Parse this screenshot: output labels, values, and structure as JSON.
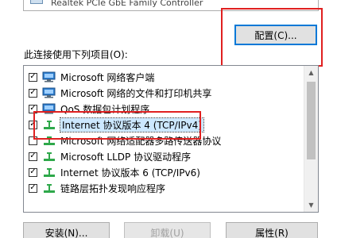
{
  "adapter": {
    "name": "Realtek PCIe GbE Family Controller"
  },
  "buttons": {
    "configure": "配置(C)...",
    "install": "安装(N)...",
    "uninstall": "卸载(U)",
    "properties": "属性(R)"
  },
  "section_label": "此连接使用下列项目(O):",
  "items": [
    {
      "label": "Microsoft 网络客户端",
      "checked": true,
      "icon": "network-client-icon"
    },
    {
      "label": "Microsoft 网络的文件和打印机共享",
      "checked": true,
      "icon": "network-client-icon"
    },
    {
      "label": "QoS 数据包计划程序",
      "checked": true,
      "icon": "network-client-icon"
    },
    {
      "label": "Internet 协议版本 4 (TCP/IPv4)",
      "checked": true,
      "icon": "protocol-icon",
      "selected": true
    },
    {
      "label": "Microsoft 网络适配器多路传送器协议",
      "checked": false,
      "icon": "protocol-icon"
    },
    {
      "label": "Microsoft LLDP 协议驱动程序",
      "checked": true,
      "icon": "protocol-icon"
    },
    {
      "label": "Internet 协议版本 6 (TCP/IPv6)",
      "checked": true,
      "icon": "protocol-icon"
    },
    {
      "label": "链路层拓扑发现响应程序",
      "checked": true,
      "icon": "protocol-icon"
    }
  ],
  "check_mark": "✓",
  "colors": {
    "highlight": "#e02020",
    "selection": "#cce8ff",
    "focus": "#0078d7"
  }
}
